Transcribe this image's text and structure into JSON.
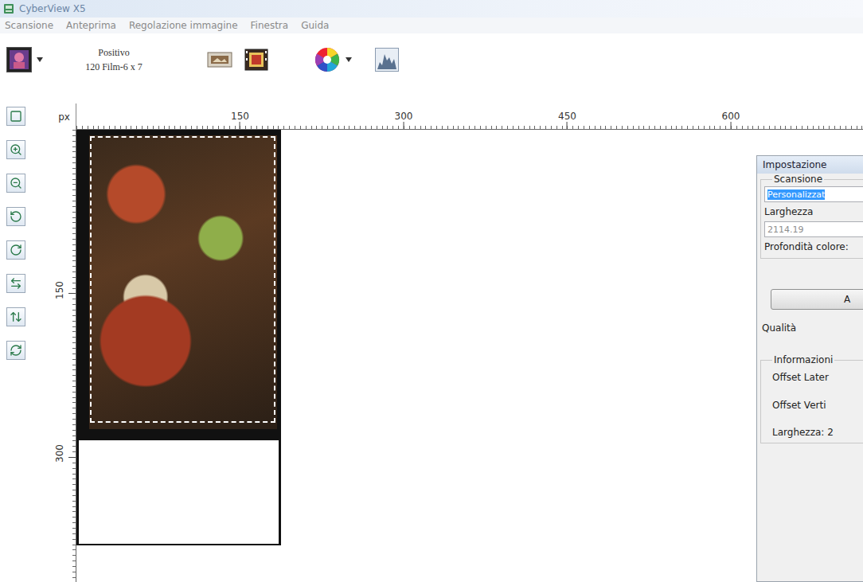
{
  "window": {
    "title": "CyberView X5"
  },
  "menu": [
    "Scansione",
    "Anteprima",
    "Regolazione immagine",
    "Finestra",
    "Guida"
  ],
  "toolbar": {
    "mode": "Positivo",
    "film": "120 Film-6 x 7"
  },
  "ruler": {
    "unit": "px",
    "top_ticks": [
      "150",
      "300",
      "450",
      "600"
    ],
    "left_ticks": [
      "150",
      "300"
    ]
  },
  "preview": {
    "selection": true
  },
  "settings_panel": {
    "title": "Impostazione",
    "scan_group": "Scansione",
    "preset": {
      "value": "Personalizzat",
      "selected": true
    },
    "width_label": "Larghezza",
    "width_field": {
      "value": "2114.19",
      "disabled": true
    },
    "depth_label": "Profondità colore:",
    "button": "A",
    "quality_label": "Qualità",
    "info_group": "Informazioni",
    "info": [
      "Offset Later",
      "Offset Verti",
      "Larghezza: 2"
    ]
  }
}
